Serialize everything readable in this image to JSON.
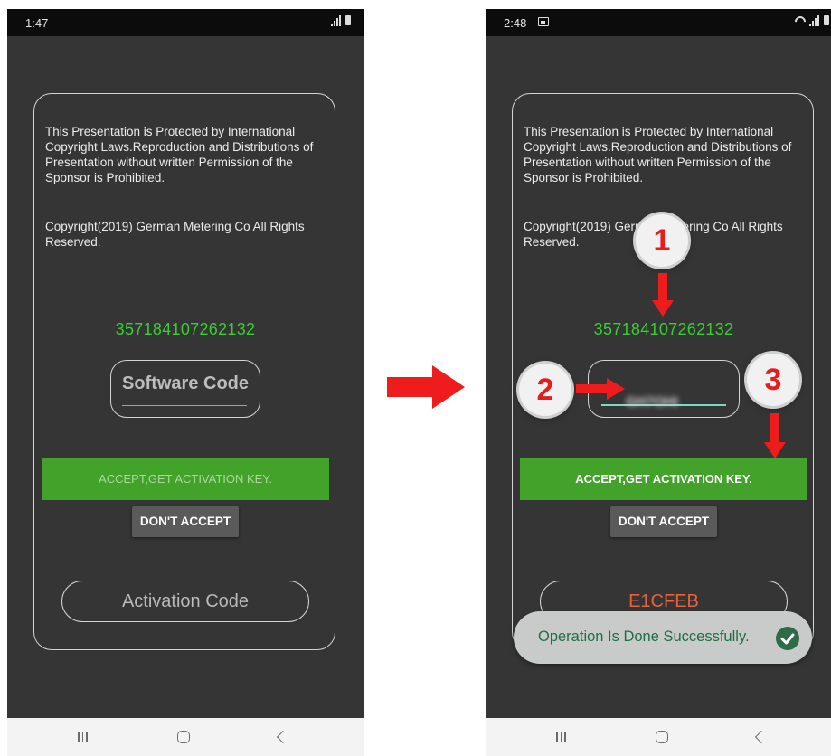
{
  "left_phone": {
    "status_time": "1:47",
    "notice": "This Presentation is Protected by International Copyright Laws.Reproduction and Distributions of Presentation without written Permission of the Sponsor is Prohibited.",
    "copyright": "Copyright(2019) German Metering Co All Rights Reserved.",
    "device_id": "357184107262132",
    "software_code_placeholder": "Software Code",
    "accept_label": "ACCEPT,GET ACTIVATION KEY.",
    "dont_accept_label": "DON'T ACCEPT",
    "activation_placeholder": "Activation Code"
  },
  "right_phone": {
    "status_time": "2:48",
    "notice": "This Presentation is Protected by International Copyright Laws.Reproduction and Distributions of Presentation without written Permission of the Sponsor is Prohibited.",
    "copyright": "Copyright(2019) German Metering Co All Rights Reserved.",
    "device_id": "357184107262132",
    "software_code_value": "GH7OHI",
    "accept_label": "ACCEPT,GET ACTIVATION KEY.",
    "dont_accept_label": "DON'T ACCEPT",
    "activation_value": "E1CFEB",
    "toast_text": "Operation Is Done Successfully."
  },
  "annotations": {
    "step_1": "1",
    "step_2": "2",
    "step_3": "3"
  },
  "colors": {
    "device_id_green": "#35d12f",
    "accept_green": "#43a22a",
    "annotation_red": "#e51d1d",
    "activation_orange": "#e8623a"
  }
}
